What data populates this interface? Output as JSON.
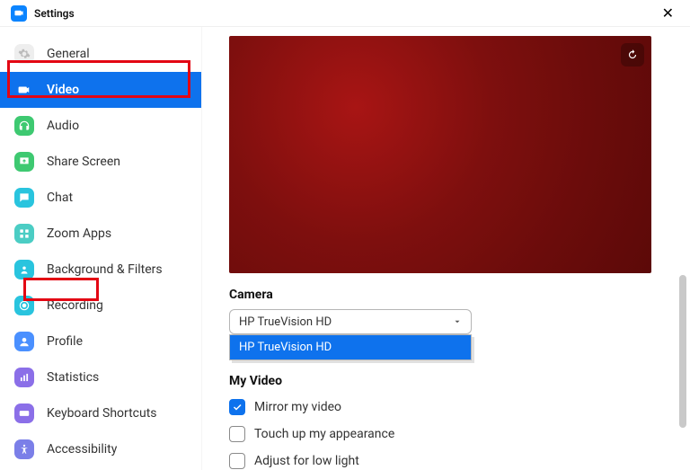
{
  "titlebar": {
    "title": "Settings"
  },
  "sidebar": {
    "items": [
      {
        "label": "General"
      },
      {
        "label": "Video"
      },
      {
        "label": "Audio"
      },
      {
        "label": "Share Screen"
      },
      {
        "label": "Chat"
      },
      {
        "label": "Zoom Apps"
      },
      {
        "label": "Background & Filters"
      },
      {
        "label": "Recording"
      },
      {
        "label": "Profile"
      },
      {
        "label": "Statistics"
      },
      {
        "label": "Keyboard Shortcuts"
      },
      {
        "label": "Accessibility"
      }
    ],
    "active_index": 1
  },
  "video": {
    "camera_label": "Camera",
    "camera_selected": "HP TrueVision HD",
    "camera_options": [
      "HP TrueVision HD"
    ],
    "my_video_label": "My Video",
    "options": [
      {
        "label": "Mirror my video",
        "checked": true
      },
      {
        "label": "Touch up my appearance",
        "checked": false
      },
      {
        "label": "Adjust for low light",
        "checked": false
      }
    ]
  },
  "colors": {
    "accent": "#0E72ED"
  }
}
